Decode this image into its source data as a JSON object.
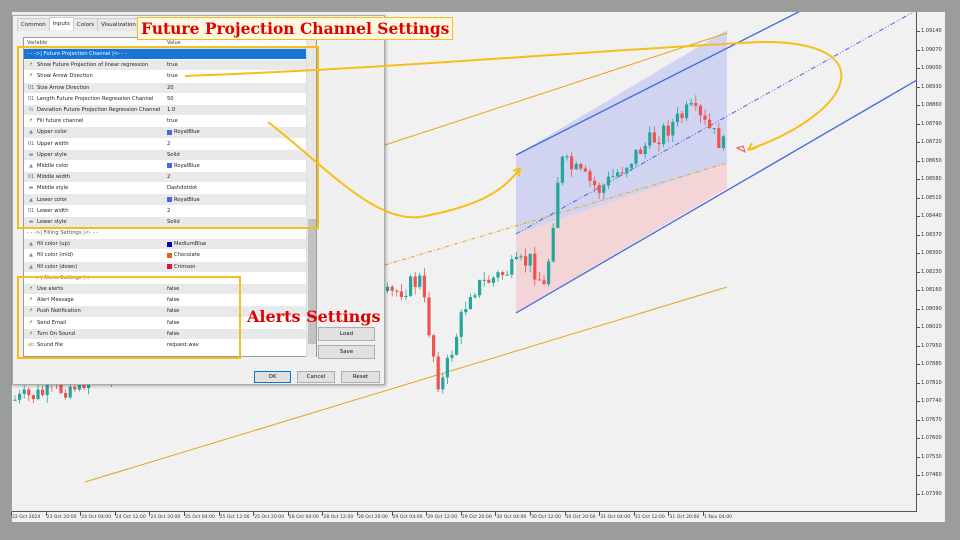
{
  "dialog": {
    "tabs": [
      "Common",
      "Inputs",
      "Colors",
      "Visualization"
    ],
    "active_tab": "Inputs",
    "columns": [
      "Variable",
      "Value"
    ],
    "rows": [
      {
        "icon": "section",
        "name": "- - ->| Future Projection Channel |<- - -",
        "value": ""
      },
      {
        "icon": "bool",
        "name": "Show Future Projection of linear regression",
        "value": "true"
      },
      {
        "icon": "bool",
        "name": "Show Arrow Direction",
        "value": "true"
      },
      {
        "icon": "int",
        "name": "Size Arrow Direction",
        "value": "20"
      },
      {
        "icon": "int",
        "name": "Length Future Projection Regression Channel",
        "value": "50"
      },
      {
        "icon": "double",
        "name": "Deviation Future Projection Regression Channel",
        "value": "1.0"
      },
      {
        "icon": "bool",
        "name": "Fill future channel",
        "value": "true"
      },
      {
        "icon": "color",
        "name": "Upper color",
        "value": "RoyalBlue",
        "swatch": "#4169e1"
      },
      {
        "icon": "int",
        "name": "Upper width",
        "value": "2"
      },
      {
        "icon": "style",
        "name": "Upper style",
        "value": "Solid"
      },
      {
        "icon": "color",
        "name": "Middle color",
        "value": "RoyalBlue",
        "swatch": "#4169e1"
      },
      {
        "icon": "int",
        "name": "Middle width",
        "value": "2"
      },
      {
        "icon": "style",
        "name": "Middle style",
        "value": "Dashdotdot"
      },
      {
        "icon": "color",
        "name": "Lower color",
        "value": "RoyalBlue",
        "swatch": "#4169e1"
      },
      {
        "icon": "int",
        "name": "Lower width",
        "value": "2"
      },
      {
        "icon": "style",
        "name": "Lower style",
        "value": "Solid"
      },
      {
        "icon": "section",
        "name": "- - ->| Filling Settings |<- - -",
        "value": ""
      },
      {
        "icon": "color",
        "name": "fill color (up)",
        "value": "MediumBlue",
        "swatch": "#0000cd"
      },
      {
        "icon": "color",
        "name": "fill color (mid)",
        "value": "Chocolate",
        "swatch": "#d2691e"
      },
      {
        "icon": "color",
        "name": "fill color (down)",
        "value": "Crimson",
        "swatch": "#dc143c"
      },
      {
        "icon": "section",
        "name": "- - ->| Alerts Settings |<- - -",
        "value": ""
      },
      {
        "icon": "bool",
        "name": "Use alerts",
        "value": "false"
      },
      {
        "icon": "bool",
        "name": "Alert Message",
        "value": "false"
      },
      {
        "icon": "bool",
        "name": "Push Notification",
        "value": "false"
      },
      {
        "icon": "bool",
        "name": "Send Email",
        "value": "false"
      },
      {
        "icon": "bool",
        "name": "Turn On Sound",
        "value": "false"
      },
      {
        "icon": "string",
        "name": "Sound file",
        "value": "request.wav"
      }
    ],
    "buttons": {
      "load": "Load",
      "save": "Save",
      "ok": "OK",
      "cancel": "Cancel",
      "reset": "Reset"
    }
  },
  "callouts": {
    "title": "Future Projection Channel Settings",
    "alerts": "Alerts Settings"
  },
  "chart": {
    "price_axis": [
      "1.09140",
      "1.09070",
      "1.09000",
      "1.08930",
      "1.08860",
      "1.08790",
      "1.08720",
      "1.08650",
      "1.08580",
      "1.08510",
      "1.08440",
      "1.08370",
      "1.08300",
      "1.08230",
      "1.08160",
      "1.08090",
      "1.08020",
      "1.07950",
      "1.07880",
      "1.07810",
      "1.07740",
      "1.07670",
      "1.07600",
      "1.07530",
      "1.07460",
      "1.07390"
    ],
    "time_axis": [
      "22 Oct 2024",
      "23 Oct 20:00",
      "24 Oct 04:00",
      "24 Oct 12:00",
      "24 Oct 20:00",
      "25 Oct 04:00",
      "25 Oct 12:00",
      "25 Oct 20:00",
      "28 Oct 04:00",
      "28 Oct 12:00",
      "28 Oct 20:00",
      "29 Oct 04:00",
      "29 Oct 12:00",
      "29 Oct 20:00",
      "30 Oct 04:00",
      "30 Oct 12:00",
      "30 Oct 20:00",
      "31 Oct 04:00",
      "31 Oct 12:00",
      "31 Oct 20:00",
      "1 Nov 04:00"
    ],
    "colors": {
      "bull": "#26a69a",
      "bear": "#ef5350",
      "channel": "#4169e1",
      "regression": "#e8a317",
      "annotation": "#f6be1a"
    }
  }
}
